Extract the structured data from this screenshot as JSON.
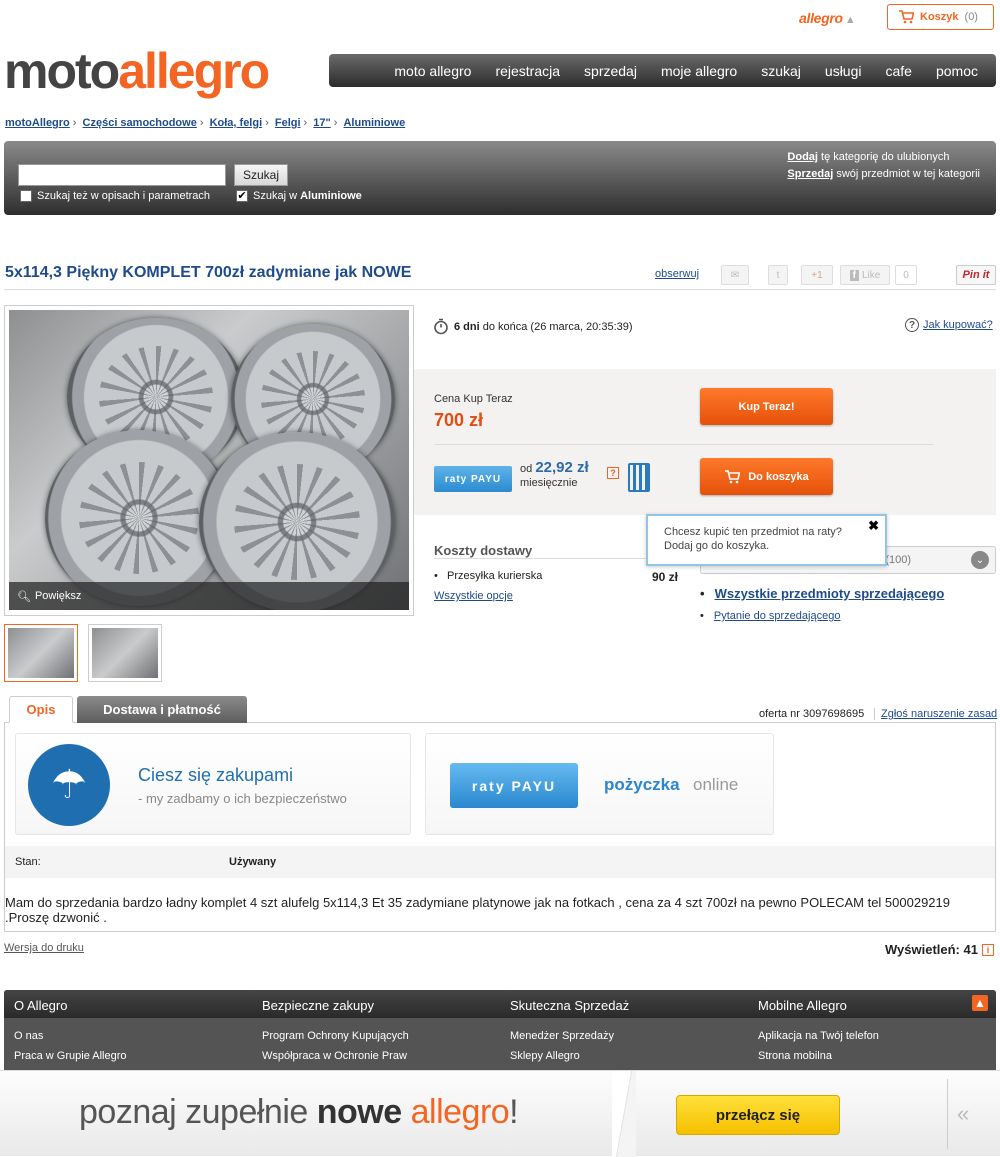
{
  "top": {
    "allegro_label": "allegro",
    "cart_label": "Koszyk",
    "cart_count": "(0)"
  },
  "logo": {
    "part1": "moto",
    "part2": "allegro"
  },
  "nav": [
    "moto allegro",
    "rejestracja",
    "sprzedaj",
    "moje allegro",
    "szukaj",
    "usługi",
    "cafe",
    "pomoc"
  ],
  "breadcrumb": [
    "motoAllegro",
    "Części samochodowe",
    "Koła, felgi",
    "Felgi",
    "17\"",
    "Aluminiowe"
  ],
  "search": {
    "placeholder": "",
    "button": "Szukaj",
    "check1": "Szukaj też w opisach i parametrach",
    "check2_prefix": "Szukaj w ",
    "check2_cat": "Aluminiowe",
    "fav_link": "Dodaj",
    "fav_text": " tę kategorię do ulubionych",
    "sell_link": "Sprzedaj",
    "sell_text": " swój przedmiot w tej kategorii"
  },
  "item": {
    "title": "5x114,3 Piękny KOMPLET 700zł zadymiane jak NOWE",
    "observe": "obserwuj",
    "gplus": "+1",
    "like": "Like",
    "like_count": "0",
    "pin": "Pin it",
    "zoom": "Powiększ"
  },
  "buy": {
    "days": "6 dni",
    "ends": " do końca (26 marca, 20:35:39)",
    "how_to_buy": "Jak kupować?",
    "price_label": "Cena Kup Teraz",
    "price": "700 zł",
    "buy_now": "Kup Teraz!",
    "to_cart": "Do koszyka",
    "raty_badge": "raty PAYU",
    "from": "od",
    "installment": "22,92 zł",
    "monthly": "miesięcznie"
  },
  "tooltip": {
    "text1": "Chcesz kupić ten przedmiot na raty?",
    "text2": "Dodaj go do koszyka.",
    "close": "✖"
  },
  "shipping": {
    "title": "Koszty dostawy",
    "method": "Przesyłka kurierska",
    "price": "90 zł",
    "all_options": "Wszystkie opcje"
  },
  "seller": {
    "rating": "(100)",
    "all_items": "Wszystkie przedmioty sprzedającego",
    "ask": "Pytanie do sprzedającego"
  },
  "tabs": {
    "desc": "Opis",
    "delivery": "Dostawa i płatność"
  },
  "offer": {
    "nr": "oferta nr 3097698695",
    "report": "Zgłoś naruszenie zasad"
  },
  "promo": {
    "title": "Ciesz się zakupami",
    "subtitle": "-  my zadbamy o ich bezpieczeństwo",
    "raty": "raty PAYU",
    "loan": "pożyczka",
    "online": "online"
  },
  "condition": {
    "label": "Stan:",
    "value": "Używany"
  },
  "description": "Mam do sprzedania bardzo ładny komplet 4 szt alufelg 5x114,3 Et 35 zadymiane platynowe jak na fotkach , cena za 4 szt 700zł na pewno POLECAM tel 500029219 .Proszę dzwonić .",
  "print": "Wersja do druku",
  "views": "Wyświetleń: 41",
  "footer": {
    "cols": [
      {
        "head": "O Allegro",
        "items": [
          "O nas",
          "Praca w Grupie Allegro"
        ]
      },
      {
        "head": "Bezpieczne zakupy",
        "items": [
          "Program Ochrony Kupujących",
          "Współpraca w Ochronie Praw"
        ]
      },
      {
        "head": "Skuteczna Sprzedaż",
        "items": [
          "Menedżer Sprzedaży",
          "Sklepy Allegro"
        ]
      },
      {
        "head": "Mobilne Allegro",
        "items": [
          "Aplikacja na Twój telefon",
          "Strona mobilna"
        ]
      }
    ]
  },
  "banner": {
    "t1": "poznaj zupełnie ",
    "t2": "nowe",
    "t3": " allegro",
    "t4": "!",
    "button": "przełącz się",
    "collapse": "«"
  }
}
